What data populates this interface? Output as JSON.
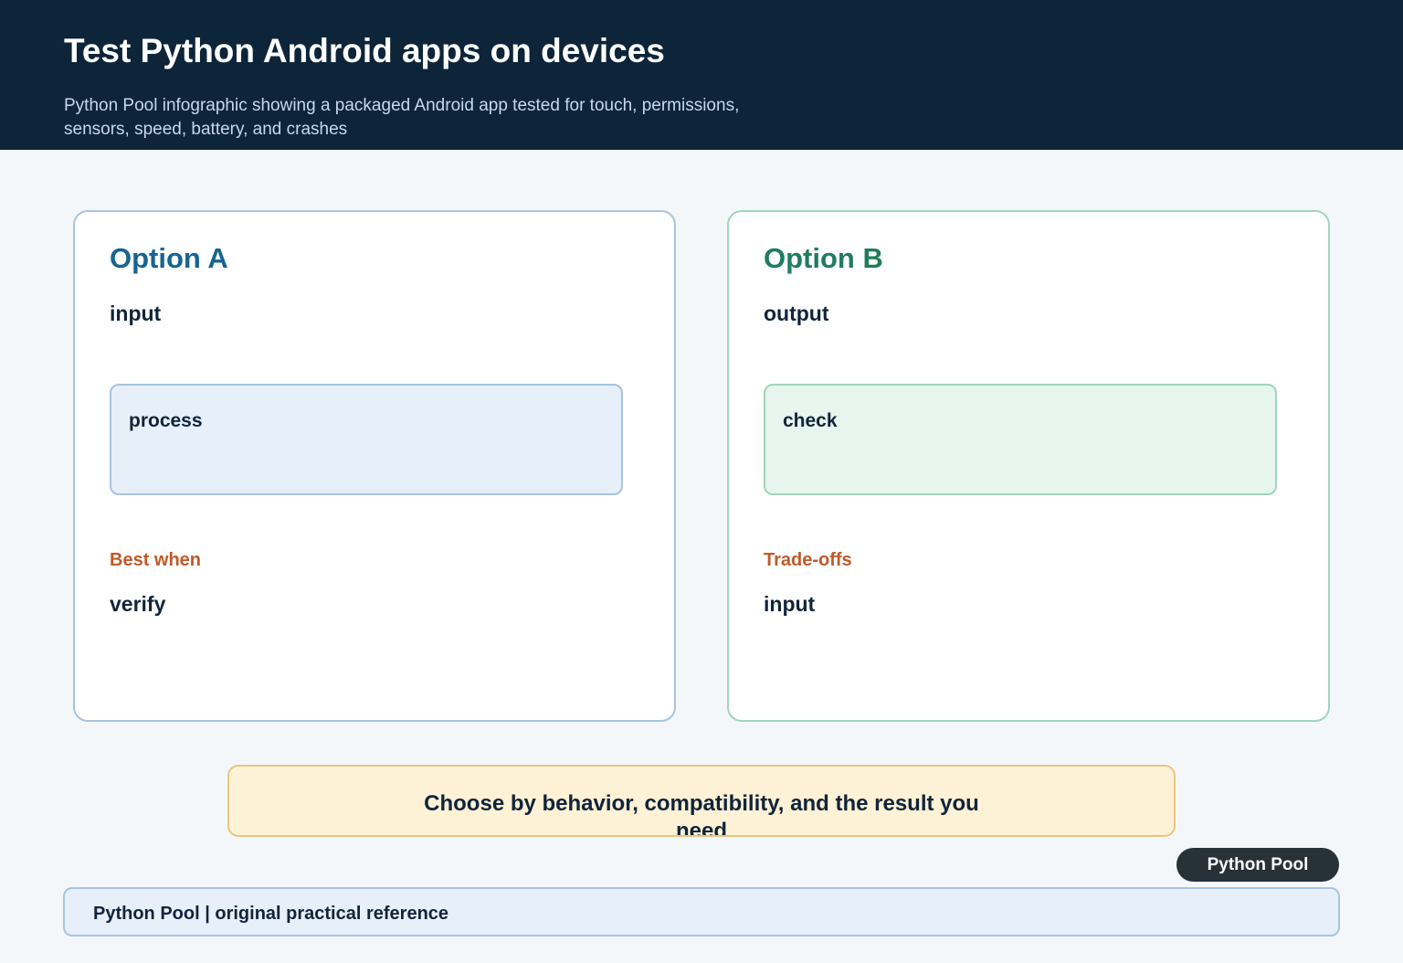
{
  "header": {
    "title": "Test Python Android apps on devices",
    "subtitle": "Python Pool infographic showing a packaged Android app tested for touch, permissions, sensors, speed, battery, and crashes"
  },
  "options": [
    {
      "title": "Option A",
      "lead": "input",
      "box_label": "process",
      "note_label": "Best when",
      "note_value": "verify",
      "accent": "#17648f"
    },
    {
      "title": "Option B",
      "lead": "output",
      "box_label": "check",
      "note_label": "Trade-offs",
      "note_value": "input",
      "accent": "#1f7d5b"
    }
  ],
  "summary": "Choose by behavior, compatibility, and the result you need",
  "badge": "Python Pool",
  "footer": "Python Pool | original practical reference",
  "colors": {
    "header_bg": "#0d2439",
    "note": "#c05a28",
    "summary_bg": "#fdf1d6"
  }
}
